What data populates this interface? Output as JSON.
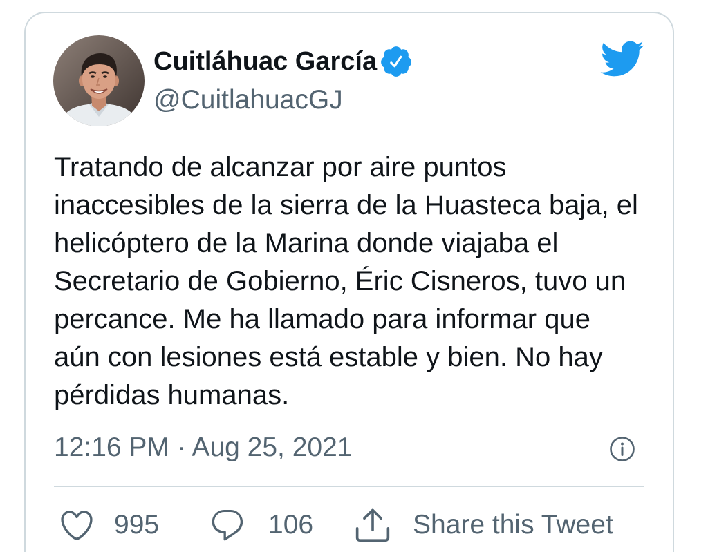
{
  "tweet_card": {
    "author": {
      "name": "Cuitláhuac García",
      "handle": "@CuitlahuacGJ",
      "verified": true,
      "verified_icon": "verified-badge-icon"
    },
    "brand_icon": "twitter-bird-icon",
    "text_lines": [
      "Tratando de alcanzar por aire puntos",
      "inaccesibles de la sierra de la Huasteca baja, el",
      "helicóptero de la Marina donde viajaba el",
      "Secretario de Gobierno, Éric Cisneros, tuvo un",
      "percance. Me ha llamado para informar que",
      "aún con lesiones está estable y bien. No hay",
      "pérdidas humanas."
    ],
    "timestamp": "12:16 PM · Aug 25, 2021",
    "info_icon": "info-icon",
    "actions": {
      "like": {
        "icon": "heart-icon",
        "count": 995
      },
      "reply": {
        "icon": "comment-icon",
        "count": 106
      },
      "share": {
        "icon": "share-icon",
        "label": "Share this Tweet"
      }
    }
  },
  "colors": {
    "accent": "#1d9bf0",
    "text_primary": "#0f1419",
    "text_secondary": "#536471",
    "border": "#cfd9de"
  }
}
